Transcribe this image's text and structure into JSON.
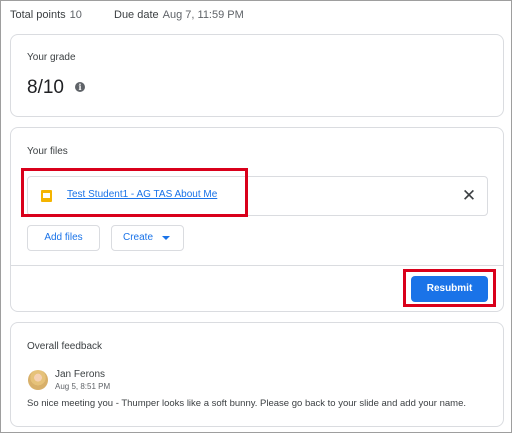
{
  "header": {
    "total_points_label": "Total points",
    "total_points_value": "10",
    "due_date_label": "Due date",
    "due_date_value": "Aug 7, 11:59 PM"
  },
  "grade": {
    "title": "Your grade",
    "value": "8/10",
    "info_icon": "info-icon"
  },
  "files": {
    "title": "Your files",
    "file_name": "Test Student1 - AG TAS About Me",
    "file_icon": "slides-icon",
    "remove_icon": "close-icon",
    "add_files_label": "Add files",
    "create_label": "Create",
    "resubmit_label": "Resubmit"
  },
  "feedback": {
    "title": "Overall feedback",
    "author": "Jan Ferons",
    "timestamp": "Aug 5, 8:51 PM",
    "comment": "So nice meeting you - Thumper looks like a soft bunny. Please go back to your slide and add your name."
  },
  "colors": {
    "accent": "#1a73e8",
    "annotation": "#d9001b",
    "slides_icon": "#f4b400"
  }
}
